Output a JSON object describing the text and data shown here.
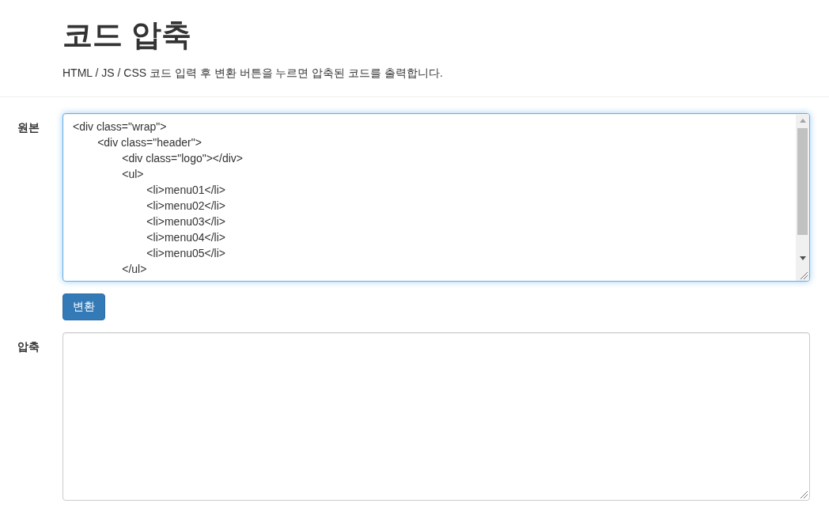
{
  "header": {
    "title": "코드 압축",
    "description": "HTML / JS / CSS 코드 입력 후 변환 버튼을 누르면 압축된 코드를 출력합니다."
  },
  "source": {
    "label": "원본",
    "focused": true,
    "lines": [
      "<div class=\"wrap\">",
      "\t<div class=\"header\">",
      "\t\t<div class=\"logo\"></div>",
      "\t\t<ul>",
      "\t\t\t<li>menu01</li>",
      "\t\t\t<li>menu02</li>",
      "\t\t\t<li>menu03</li>",
      "\t\t\t<li>menu04</li>",
      "\t\t\t<li>menu05</li>",
      "\t\t</ul>"
    ]
  },
  "button": {
    "label": "변환"
  },
  "output": {
    "label": "압축",
    "focused": false
  }
}
